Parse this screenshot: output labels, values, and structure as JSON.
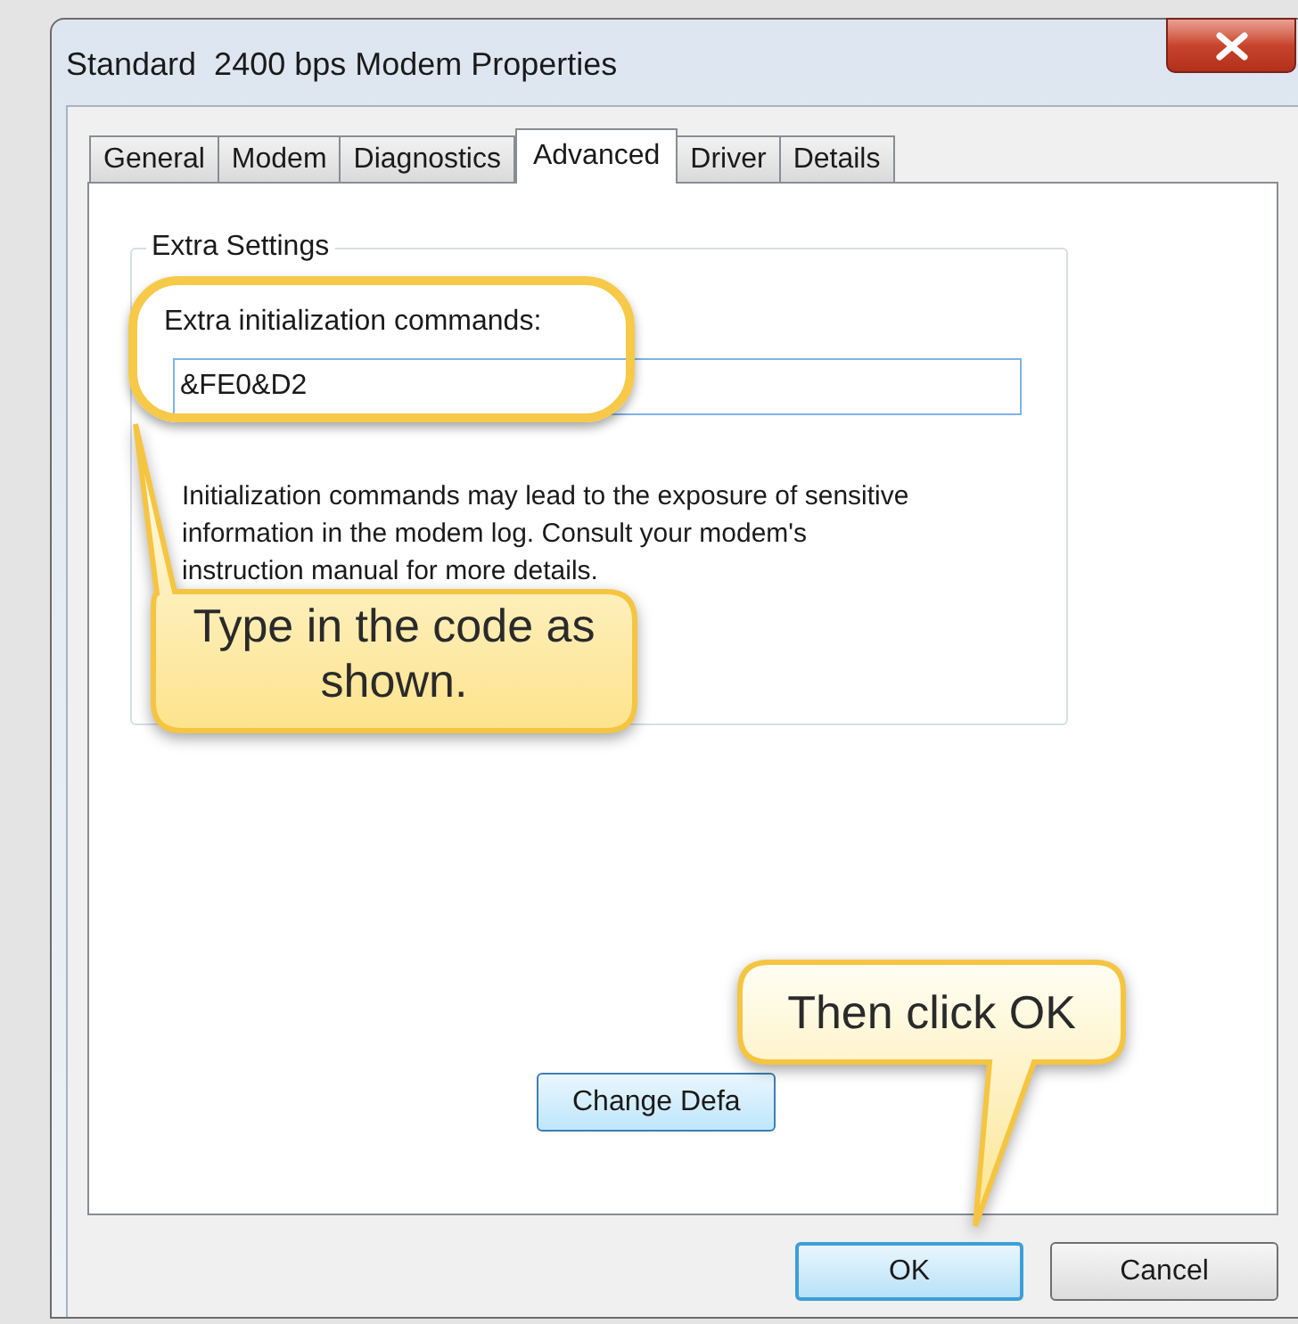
{
  "window": {
    "title": "Standard  2400 bps Modem Properties"
  },
  "tabs": [
    {
      "label": "General",
      "selected": false
    },
    {
      "label": "Modem",
      "selected": false
    },
    {
      "label": "Diagnostics",
      "selected": false
    },
    {
      "label": "Advanced",
      "selected": true
    },
    {
      "label": "Driver",
      "selected": false
    },
    {
      "label": "Details",
      "selected": false
    }
  ],
  "extra_settings": {
    "title": "Extra Settings",
    "field_label": "Extra initialization commands:",
    "field_value": "&FE0&D2",
    "note": "Initialization commands may lead to the exposure of sensitive information in the modem log. Consult your modem's instruction manual for more details."
  },
  "change_button": "Change Defa",
  "buttons": [
    {
      "label": "OK",
      "default": true
    },
    {
      "label": "Cancel",
      "default": false
    }
  ],
  "callouts": [
    {
      "text": "Type in the code as shown."
    },
    {
      "text": "Then click OK"
    }
  ]
}
